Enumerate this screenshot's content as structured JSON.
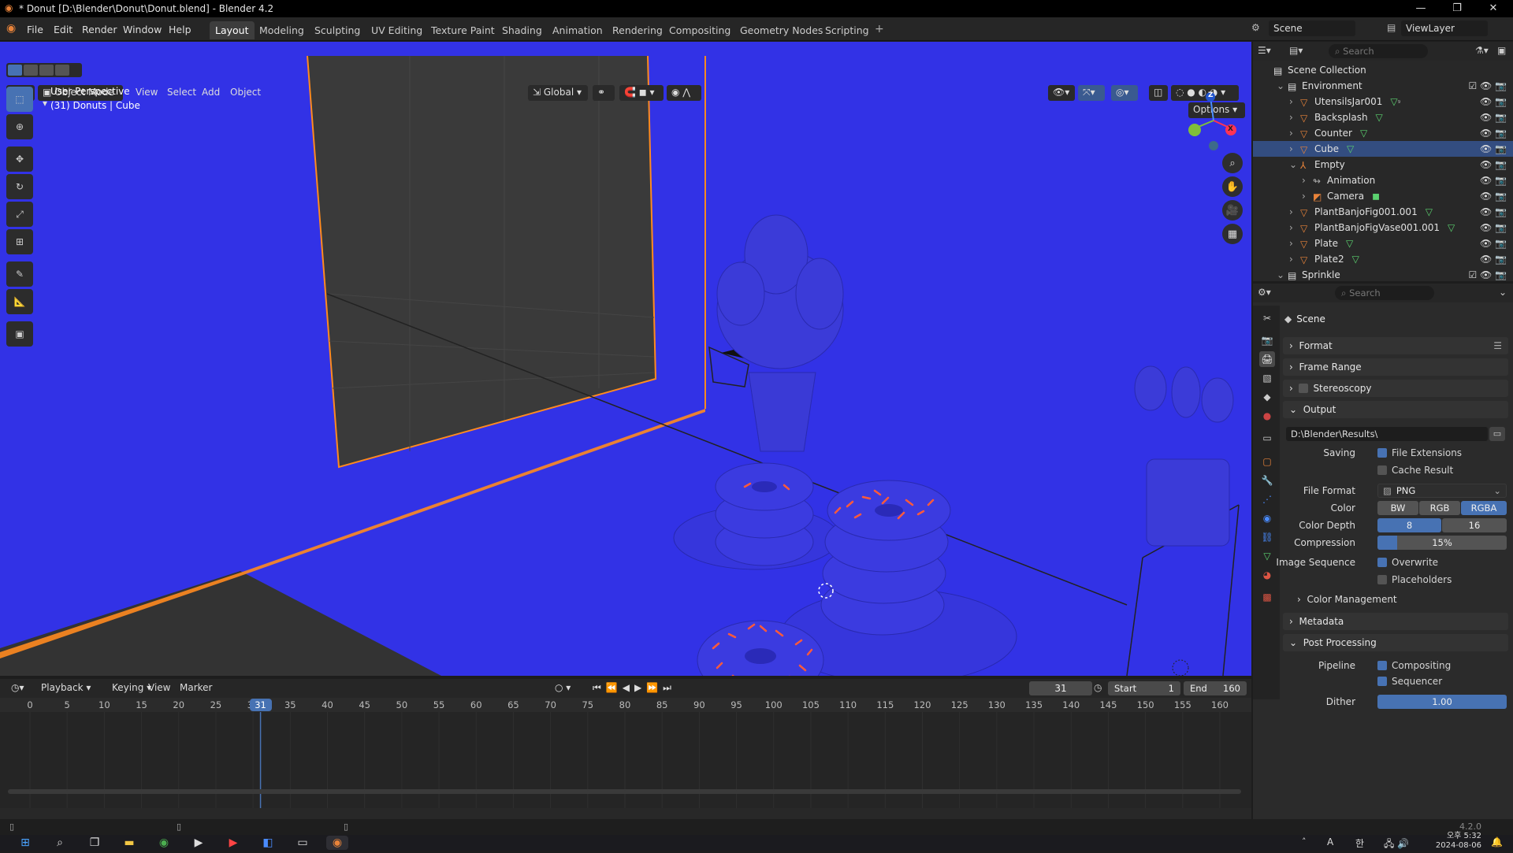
{
  "window": {
    "title": "* Donut [D:\\Blender\\Donut\\Donut.blend] - Blender 4.2",
    "controls": [
      "—",
      "❐",
      "✕"
    ]
  },
  "menus": [
    "File",
    "Edit",
    "Render",
    "Window",
    "Help"
  ],
  "workspaces": [
    "Layout",
    "Modeling",
    "Sculpting",
    "UV Editing",
    "Texture Paint",
    "Shading",
    "Animation",
    "Rendering",
    "Compositing",
    "Geometry Nodes",
    "Scripting"
  ],
  "active_workspace": "Layout",
  "scene_selector": {
    "scene": "Scene",
    "view_layer": "ViewLayer"
  },
  "viewport_header": {
    "mode": "Object Mode",
    "menus": [
      "View",
      "Select",
      "Add",
      "Object"
    ],
    "orientation": "Global",
    "options": "Options"
  },
  "viewport_overlay": {
    "perspective": "User Perspective",
    "context": "(31) Donuts | Cube"
  },
  "gizmo_axes": {
    "z": "Z",
    "x": "X"
  },
  "timeline": {
    "menus": [
      "Playback",
      "Keying",
      "View",
      "Marker"
    ],
    "current_frame": "31",
    "start_label": "Start",
    "start": "1",
    "end_label": "End",
    "end": "160",
    "ticks": [
      "0",
      "5",
      "10",
      "15",
      "20",
      "25",
      "30",
      "35",
      "40",
      "45",
      "50",
      "55",
      "60",
      "65",
      "70",
      "75",
      "80",
      "85",
      "90",
      "95",
      "100",
      "105",
      "110",
      "115",
      "120",
      "125",
      "130",
      "135",
      "140",
      "145",
      "150",
      "155",
      "160"
    ],
    "playhead": "31"
  },
  "outliner": {
    "search_placeholder": "Search",
    "root": "Scene Collection",
    "rows": [
      {
        "label": "Environment",
        "indent": 1,
        "kind": "collection",
        "expanded": true
      },
      {
        "label": "UtensilsJar001",
        "indent": 2,
        "kind": "object",
        "badge": "₉"
      },
      {
        "label": "Backsplash",
        "indent": 2,
        "kind": "object"
      },
      {
        "label": "Counter",
        "indent": 2,
        "kind": "object"
      },
      {
        "label": "Cube",
        "indent": 2,
        "kind": "object",
        "selected": true
      },
      {
        "label": "Empty",
        "indent": 2,
        "kind": "empty",
        "expanded": true
      },
      {
        "label": "Animation",
        "indent": 3,
        "kind": "action"
      },
      {
        "label": "Camera",
        "indent": 3,
        "kind": "camera"
      },
      {
        "label": "PlantBanjoFig001.001",
        "indent": 2,
        "kind": "object"
      },
      {
        "label": "PlantBanjoFigVase001.001",
        "indent": 2,
        "kind": "object"
      },
      {
        "label": "Plate",
        "indent": 2,
        "kind": "object"
      },
      {
        "label": "Plate2",
        "indent": 2,
        "kind": "object"
      },
      {
        "label": "Sprinkle",
        "indent": 1,
        "kind": "collection",
        "expanded": true
      }
    ]
  },
  "properties": {
    "search_placeholder": "Search",
    "context": "Scene",
    "sections": {
      "format": "Format",
      "frame_range": "Frame Range",
      "stereoscopy": "Stereoscopy",
      "output": "Output",
      "color_management": "Color Management",
      "metadata": "Metadata",
      "post_processing": "Post Processing"
    },
    "output_path": "D:\\Blender\\Results\\",
    "saving_label": "Saving",
    "file_extensions": "File Extensions",
    "cache_result": "Cache Result",
    "file_format_label": "File Format",
    "file_format": "PNG",
    "color_label": "Color",
    "color_options": [
      "BW",
      "RGB",
      "RGBA"
    ],
    "color_selected": "RGBA",
    "color_depth_label": "Color Depth",
    "color_depth_options": [
      "8",
      "16"
    ],
    "color_depth_selected": "8",
    "compression_label": "Compression",
    "compression": "15%",
    "compression_fraction": 0.15,
    "image_sequence_label": "Image Sequence",
    "overwrite": "Overwrite",
    "placeholders": "Placeholders",
    "pipeline_label": "Pipeline",
    "compositing": "Compositing",
    "sequencer": "Sequencer",
    "dither_label": "Dither",
    "dither": "1.00"
  },
  "status_version": "4.2.0",
  "taskbar": {
    "time": "오후 5:32",
    "date": "2024-08-06",
    "ime_a": "A",
    "ime_han": "한"
  },
  "colors": {
    "viewport_bg": "#3232e6",
    "selection": "#4772b3",
    "outline": "#ff8a1f",
    "sprinkle": "#ff5a3a"
  }
}
